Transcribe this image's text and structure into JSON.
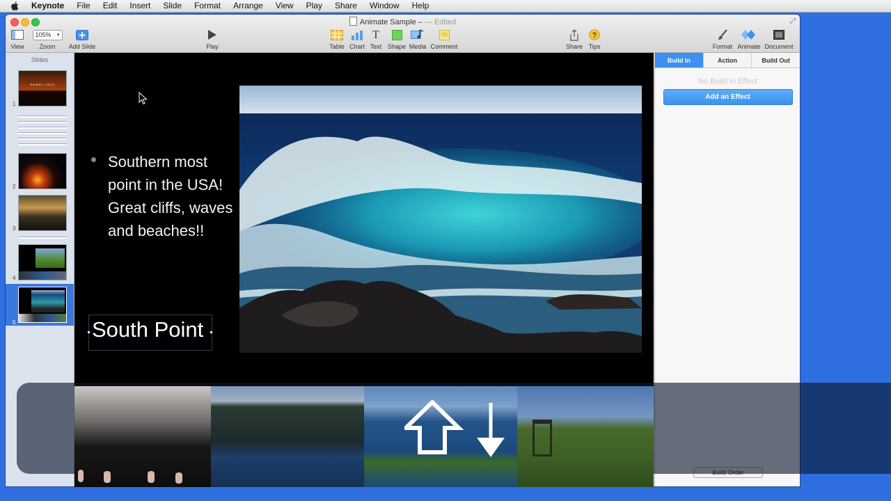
{
  "menubar": {
    "items": [
      "Keynote",
      "File",
      "Edit",
      "Insert",
      "Slide",
      "Format",
      "Arrange",
      "View",
      "Play",
      "Share",
      "Window",
      "Help"
    ]
  },
  "window": {
    "title": "Animate Sample –",
    "edited": "— Edited"
  },
  "toolbar": {
    "view": "View",
    "zoom_label": "Zoom",
    "zoom_value": "105%",
    "add_slide": "Add Slide",
    "play": "Play",
    "table": "Table",
    "chart": "Chart",
    "text": "Text",
    "shape": "Shape",
    "media": "Media",
    "comment": "Comment",
    "share": "Share",
    "tips": "Tips",
    "format": "Format",
    "animate": "Animate",
    "document": "Document"
  },
  "navigator": {
    "title": "Slides",
    "slides": [
      {
        "number": "1",
        "caption": "HAWAII 2014"
      },
      {
        "number": "2",
        "caption": ""
      },
      {
        "number": "3",
        "caption": ""
      },
      {
        "number": "4",
        "caption": ""
      },
      {
        "number": "5",
        "caption": ""
      }
    ]
  },
  "slide": {
    "bullet": "Southern most point in the USA! Great cliffs, waves and beaches!!",
    "title": "South Point"
  },
  "inspector": {
    "tabs": [
      "Build In",
      "Action",
      "Build Out"
    ],
    "active_tab": "Build In",
    "empty_message": "No Build In Effect",
    "add_effect": "Add an Effect",
    "build_order": "Build Order"
  },
  "colors": {
    "desktop": "#2f6fe0",
    "accent": "#3d8ff0",
    "selection": "#3a78dd"
  }
}
